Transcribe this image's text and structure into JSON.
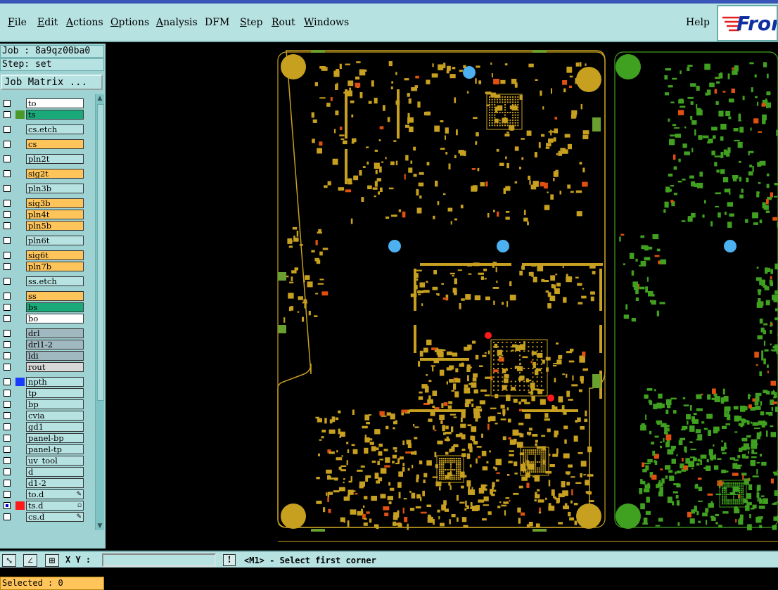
{
  "menu": {
    "items": [
      {
        "label": "File"
      },
      {
        "label": "Edit"
      },
      {
        "label": "Actions"
      },
      {
        "label": "Options"
      },
      {
        "label": "Analysis"
      },
      {
        "label": "DFM"
      },
      {
        "label": "Step"
      },
      {
        "label": "Rout"
      },
      {
        "label": "Windows"
      }
    ],
    "help": "Help",
    "logo_text": "Fron"
  },
  "sidebar": {
    "job": "Job : 8a9qz00ba0",
    "step": "Step: set",
    "job_matrix_button": "Job Matrix ...",
    "layers": [
      {
        "name": "to",
        "color": "#ffffff",
        "swatch": ""
      },
      {
        "name": "ts",
        "color": "#1aaa7a",
        "swatch": "#4a9a2a"
      },
      {
        "name": "cs.etch",
        "color": "#b7e2e2",
        "swatch": ""
      },
      {
        "name": "cs",
        "color": "#ffc55a",
        "swatch": ""
      },
      {
        "name": "pln2t",
        "color": "#b7e2e2",
        "swatch": ""
      },
      {
        "name": "sig2t",
        "color": "#ffc55a",
        "swatch": ""
      },
      {
        "name": "pln3b",
        "color": "#b7e2e2",
        "swatch": ""
      },
      {
        "name": "sig3b",
        "color": "#ffc55a",
        "swatch": ""
      },
      {
        "name": "pln4t",
        "color": "#ffc55a",
        "swatch": ""
      },
      {
        "name": "pln5b",
        "color": "#ffc55a",
        "swatch": ""
      },
      {
        "name": "pln6t",
        "color": "#b7e2e2",
        "swatch": ""
      },
      {
        "name": "sig6t",
        "color": "#ffc55a",
        "swatch": ""
      },
      {
        "name": "pln7b",
        "color": "#ffc55a",
        "swatch": ""
      },
      {
        "name": "ss.etch",
        "color": "#b7e2e2",
        "swatch": ""
      },
      {
        "name": "ss",
        "color": "#ffc55a",
        "swatch": ""
      },
      {
        "name": "bs",
        "color": "#1aaa7a",
        "swatch": ""
      },
      {
        "name": "bo",
        "color": "#ffffff",
        "swatch": ""
      },
      {
        "name": "drl",
        "color": "#a0b8c0",
        "swatch": ""
      },
      {
        "name": "drl1-2",
        "color": "#a0b8c0",
        "swatch": ""
      },
      {
        "name": "ldi",
        "color": "#a0b8c0",
        "swatch": ""
      },
      {
        "name": "rout",
        "color": "#d8d8d8",
        "swatch": ""
      },
      {
        "name": "npth",
        "color": "#b7e2e2",
        "swatch": "#1a3aff"
      },
      {
        "name": "tp",
        "color": "#b7e2e2",
        "swatch": ""
      },
      {
        "name": "bp",
        "color": "#b7e2e2",
        "swatch": ""
      },
      {
        "name": "cvia",
        "color": "#b7e2e2",
        "swatch": ""
      },
      {
        "name": "gd1",
        "color": "#b7e2e2",
        "swatch": ""
      },
      {
        "name": "panel-bp",
        "color": "#b7e2e2",
        "swatch": ""
      },
      {
        "name": "panel-tp",
        "color": "#b7e2e2",
        "swatch": ""
      },
      {
        "name": "uv_tool",
        "color": "#b7e2e2",
        "swatch": ""
      },
      {
        "name": "d",
        "color": "#b7e2e2",
        "swatch": ""
      },
      {
        "name": "d1-2",
        "color": "#b7e2e2",
        "swatch": ""
      },
      {
        "name": "to.d",
        "color": "#b7e2e2",
        "swatch": ""
      },
      {
        "name": "ts.d",
        "color": "#b7e2e2",
        "swatch": "#ff1a1a"
      },
      {
        "name": "cs.d",
        "color": "#b7e2e2",
        "swatch": ""
      }
    ],
    "selected": "Selected : 0"
  },
  "statusbar": {
    "xy_label": "X Y :",
    "xy_value": "",
    "message": "<M1> - Select first corner"
  },
  "colors": {
    "panel_bg": "#b7e2e2",
    "active_layer": "#ffc55a",
    "board_top": "#c8a020",
    "board_bottom": "#40a020"
  }
}
